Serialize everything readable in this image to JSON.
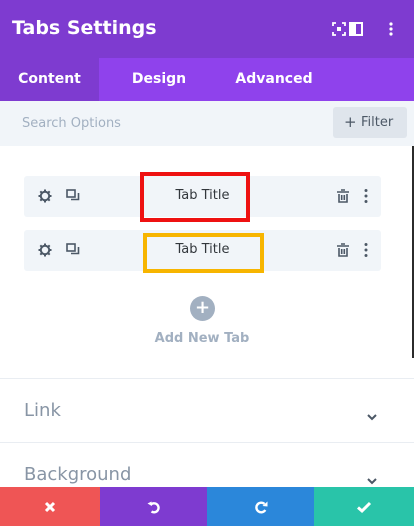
{
  "header": {
    "title": "Tabs Settings",
    "icons": [
      "expand-icon",
      "sidebar-layout-icon",
      "more-vertical-icon"
    ],
    "bg_color": "#7e3bd0"
  },
  "tabs": {
    "items": [
      {
        "label": "Content",
        "active": true
      },
      {
        "label": "Design",
        "active": false
      },
      {
        "label": "Advanced",
        "active": false
      }
    ]
  },
  "search": {
    "placeholder": "Search Options",
    "filter_label": "Filter",
    "filter_icon": "+"
  },
  "tab_items": [
    {
      "label": "Tab Title",
      "highlight": "#ee1111",
      "icons": [
        "gear-icon",
        "duplicate-icon",
        "trash-icon",
        "more-vertical-icon"
      ]
    },
    {
      "label": "Tab Title",
      "highlight": "#f7b500",
      "icons": [
        "gear-icon",
        "duplicate-icon",
        "trash-icon",
        "more-vertical-icon"
      ]
    }
  ],
  "add_tab": {
    "icon": "+",
    "label": "Add New Tab"
  },
  "sections": [
    {
      "title": "Link",
      "icon": "chevron-down-icon"
    },
    {
      "title": "Background",
      "icon": "chevron-down-icon"
    }
  ],
  "footer": {
    "buttons": [
      {
        "name": "discard",
        "icon": "close-icon",
        "color": "#ef5555"
      },
      {
        "name": "undo",
        "icon": "undo-icon",
        "color": "#7e3bd0"
      },
      {
        "name": "redo",
        "icon": "redo-icon",
        "color": "#2b87da"
      },
      {
        "name": "save",
        "icon": "check-icon",
        "color": "#29c4a9"
      }
    ]
  }
}
